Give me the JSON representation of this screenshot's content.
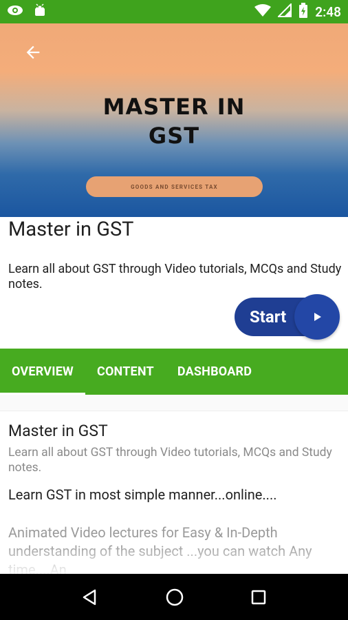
{
  "status_bar": {
    "time": "2:48",
    "left_icons": [
      "eye-icon",
      "android-icon"
    ],
    "right_icons": [
      "wifi-icon",
      "signal-icon",
      "battery-icon"
    ]
  },
  "hero": {
    "title_line1": "MASTER IN",
    "title_line2": "GST",
    "pill_text": "GOODS AND SERVICES TAX"
  },
  "course": {
    "title": "Master in GST",
    "description": "Learn all about GST through Video tutorials, MCQs and Study notes.",
    "start_label": "Start"
  },
  "tabs": [
    {
      "label": "OVERVIEW",
      "active": true
    },
    {
      "label": "CONTENT",
      "active": false
    },
    {
      "label": "DASHBOARD",
      "active": false
    }
  ],
  "overview": {
    "title": "Master in GST",
    "description": "Learn all about GST through Video tutorials, MCQs and Study notes.",
    "tagline": "Learn GST in most simple manner...online....",
    "more_text": "Animated Video lectures for Easy & In-Depth understanding of the subject ...you can watch Any time....An"
  },
  "colors": {
    "accent_green": "#47ab20",
    "button_blue": "#1f3e93"
  }
}
